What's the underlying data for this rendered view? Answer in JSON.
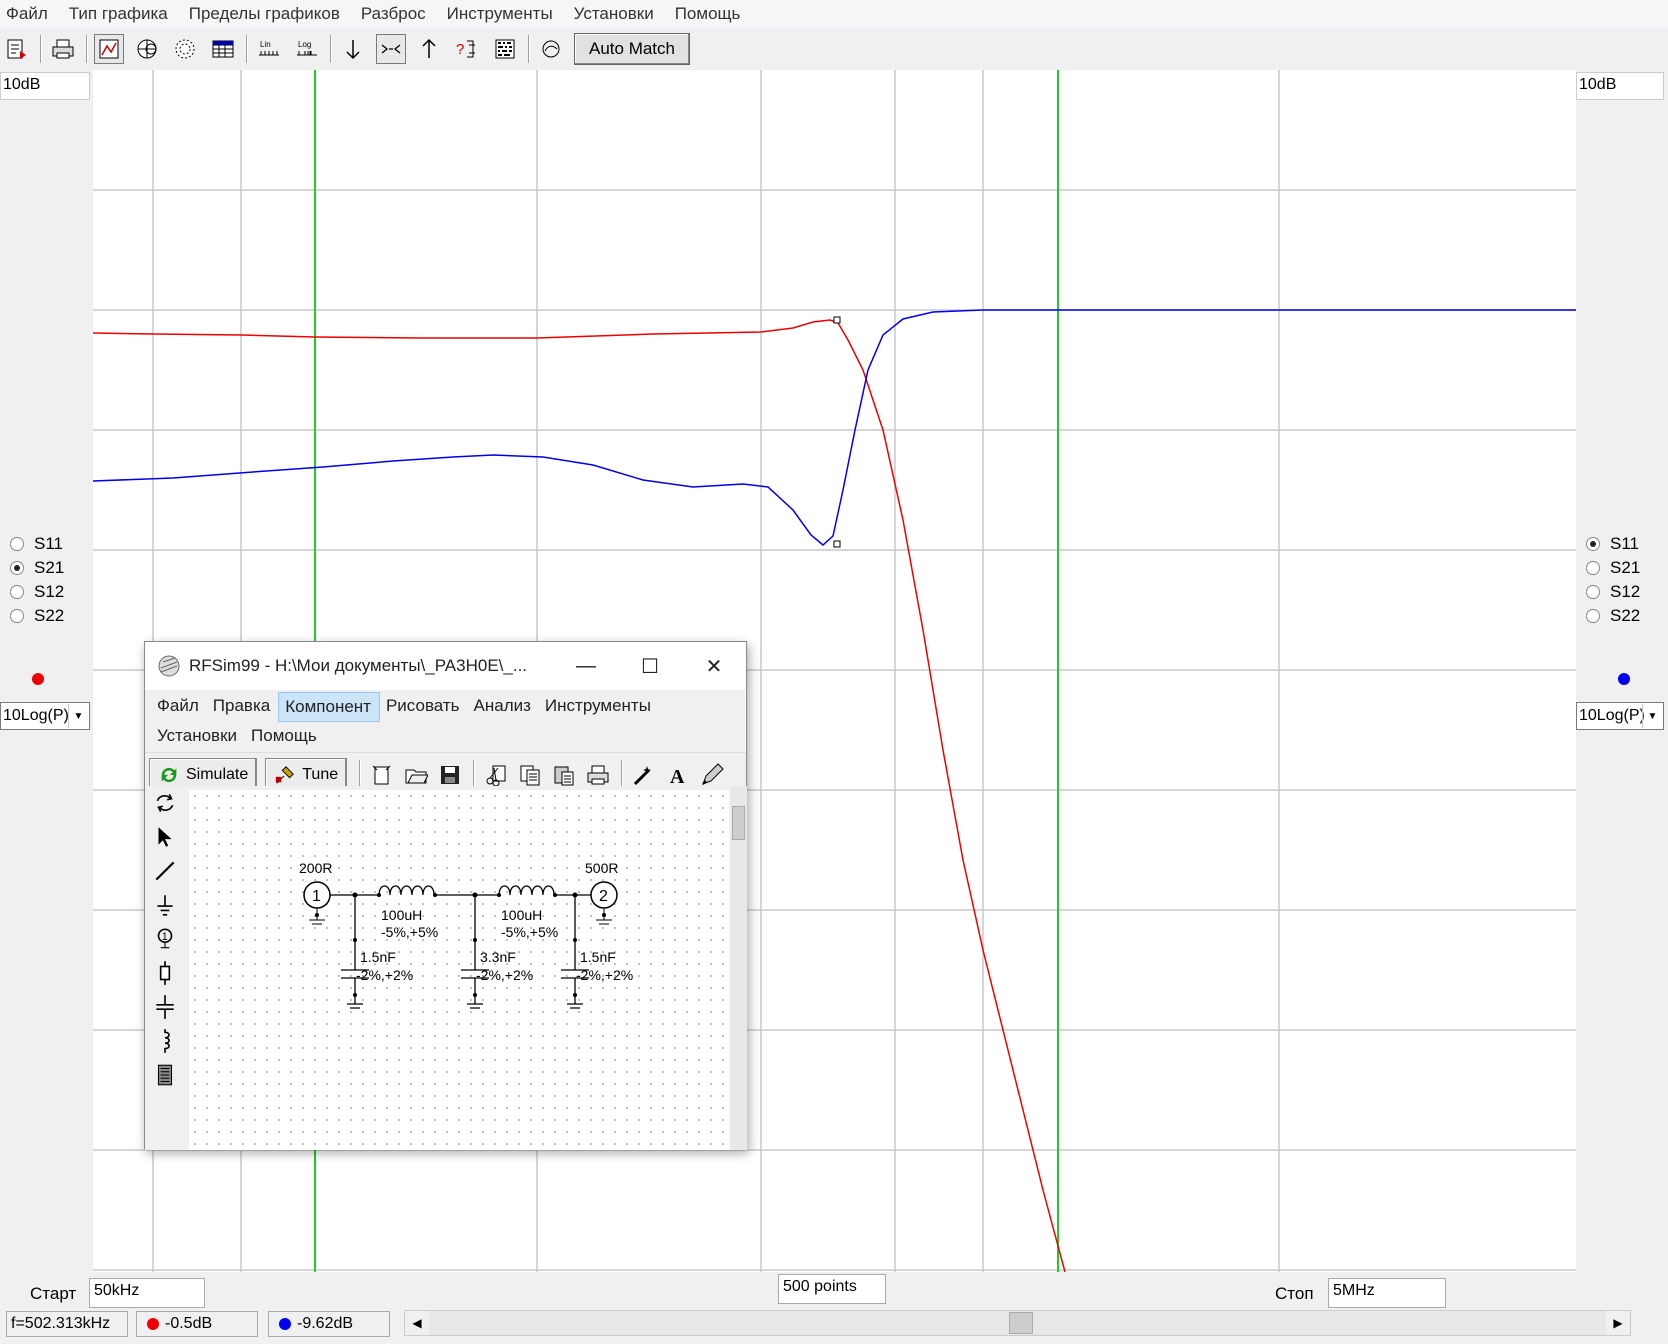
{
  "menu": [
    "Файл",
    "Тип графика",
    "Пределы графиков",
    "Разброс",
    "Инструменты",
    "Установки",
    "Помощь"
  ],
  "toolbar": {
    "auto_match": "Auto Match",
    "lin_label": "Lin",
    "log_label": "Log"
  },
  "left_panel": {
    "scale": "10dB",
    "radios": [
      {
        "label": "S11",
        "checked": false
      },
      {
        "label": "S21",
        "checked": true
      },
      {
        "label": "S12",
        "checked": false
      },
      {
        "label": "S22",
        "checked": false
      }
    ],
    "trace_color": "#ee0000",
    "mode": "10Log(P)"
  },
  "right_panel": {
    "scale": "10dB",
    "radios": [
      {
        "label": "S11",
        "checked": true
      },
      {
        "label": "S21",
        "checked": false
      },
      {
        "label": "S12",
        "checked": false
      },
      {
        "label": "S22",
        "checked": false
      }
    ],
    "trace_color": "#0000ee",
    "mode": "10Log(P)"
  },
  "bottom": {
    "start_label": "Старт",
    "start_value": "50kHz",
    "points": "500 points",
    "stop_label": "Стоп",
    "stop_value": "5MHz",
    "freq_readout": "f=502.313kHz",
    "red_readout": "-0.5dB",
    "blue_readout": "-9.62dB"
  },
  "colors": {
    "grid": "#c8c8c8",
    "marker": "#22cc22",
    "red_trace": "#ee0000",
    "blue_trace": "#0000ee"
  },
  "rfsim": {
    "title": "RFSim99 - H:\\Мои документы\\_PA3H0E\\_...",
    "menu_row1": [
      "Файл",
      "Правка",
      "Компонент",
      "Рисовать",
      "Анализ",
      "Инструменты"
    ],
    "menu_row2": [
      "Установки",
      "Помощь"
    ],
    "highlighted_menu": "Компонент",
    "simulate": "Simulate",
    "tune": "Tune",
    "schematic": {
      "port1_imp": "200R",
      "port2_imp": "500R",
      "port1_num": "1",
      "port2_num": "2",
      "l1_value": "100uH",
      "l1_tol": "-5%,+5%",
      "l2_value": "100uH",
      "l2_tol": "-5%,+5%",
      "c1_value": "1.5nF",
      "c1_tol": "-2%,+2%",
      "c2_value": "3.3nF",
      "c2_tol": "-2%,+2%",
      "c3_value": "1.5nF",
      "c3_tol": "-2%,+2%"
    }
  }
}
